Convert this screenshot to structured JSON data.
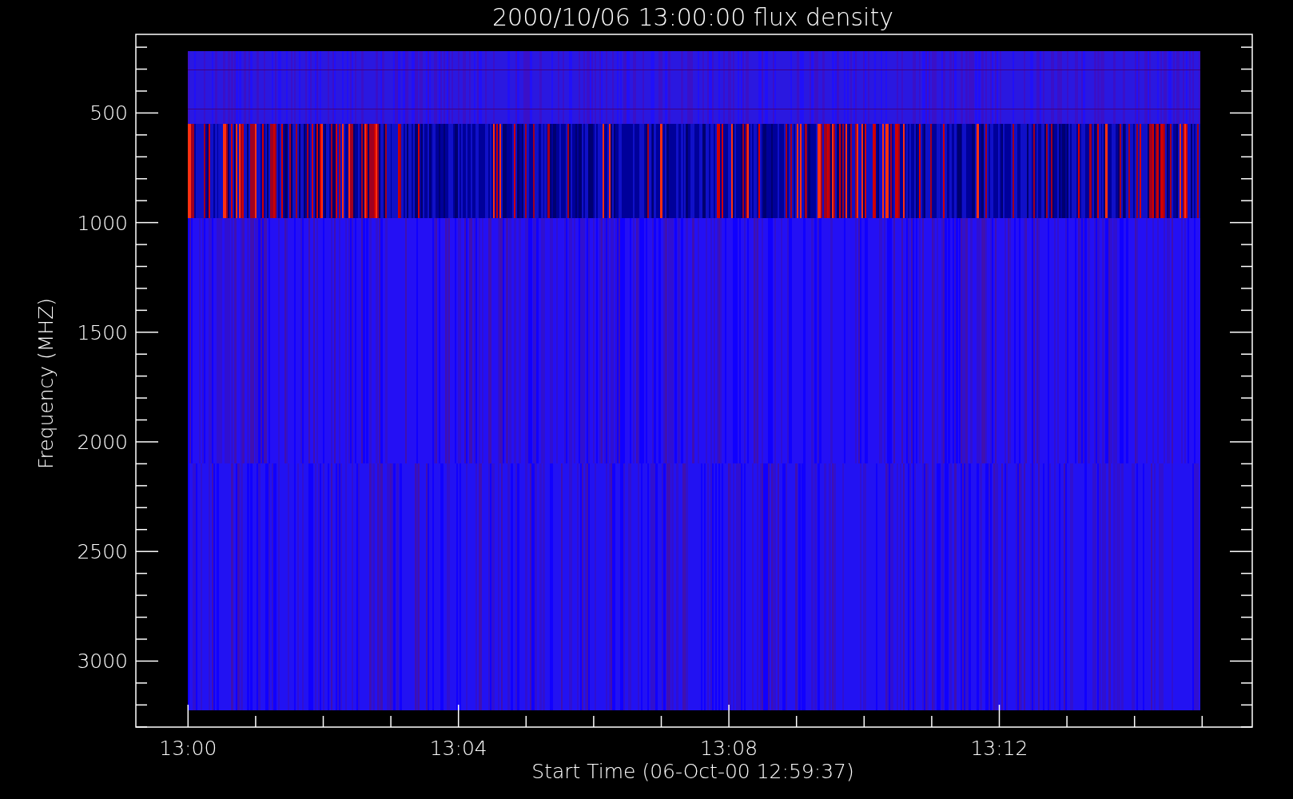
{
  "plot": {
    "title": "2000/10/06 13:00:00 flux density",
    "y_axis": {
      "label": "Frequency (MHZ)",
      "tick_labels": [
        "500",
        "1000",
        "1500",
        "2000",
        "2500",
        "3000"
      ]
    },
    "x_axis": {
      "label": "Start Time (06-Oct-00 12:59:37)",
      "tick_labels": [
        "13:00",
        "13:04",
        "13:08",
        "13:12"
      ]
    }
  }
}
